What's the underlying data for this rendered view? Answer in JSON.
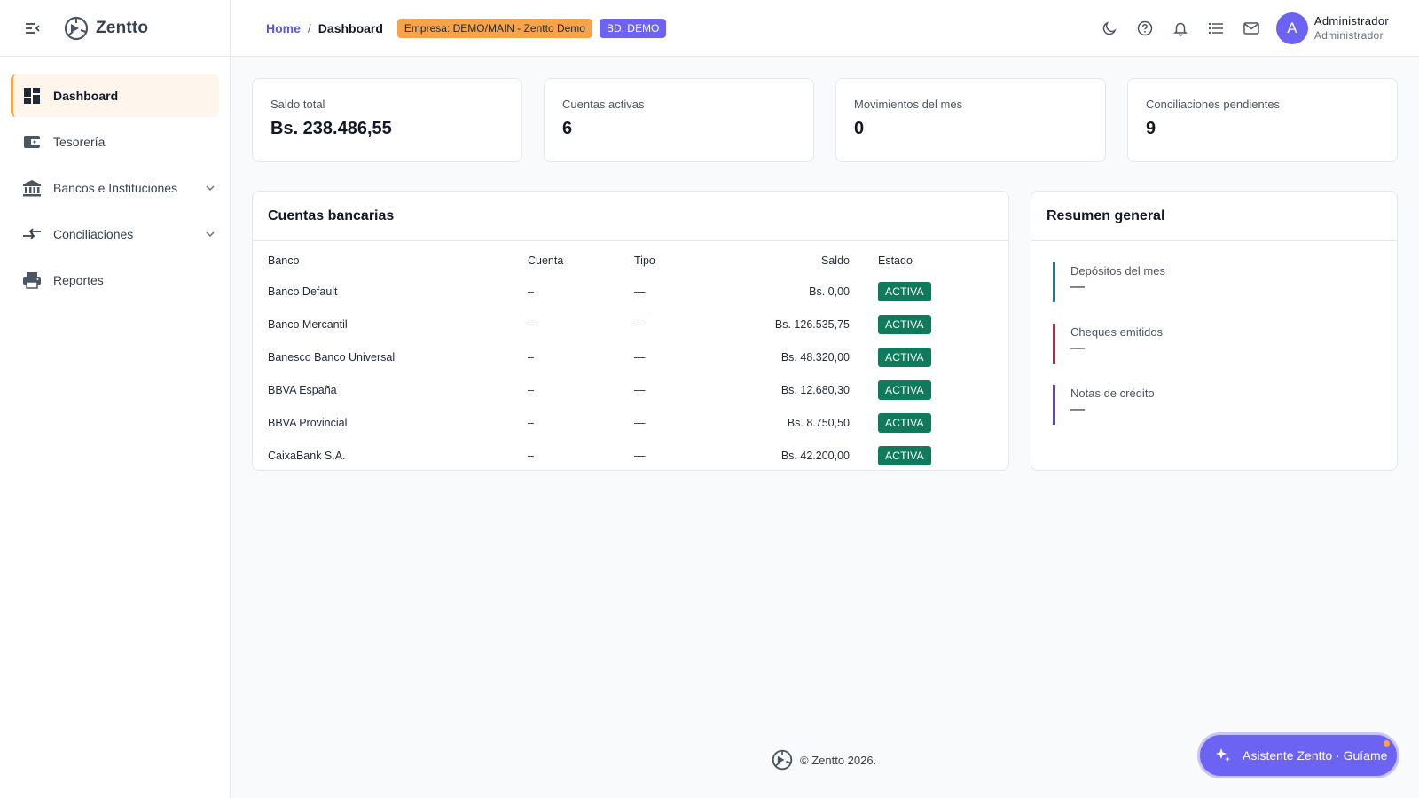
{
  "app": {
    "name": "Zentto"
  },
  "sidebar": {
    "items": [
      {
        "label": "Dashboard",
        "icon": "dashboard-icon",
        "active": true
      },
      {
        "label": "Tesorería",
        "icon": "wallet-icon"
      },
      {
        "label": "Bancos e Instituciones",
        "icon": "bank-icon",
        "expandable": true
      },
      {
        "label": "Conciliaciones",
        "icon": "compare-arrows-icon",
        "expandable": true
      },
      {
        "label": "Reportes",
        "icon": "printer-icon"
      }
    ]
  },
  "header": {
    "breadcrumb": {
      "home": "Home",
      "separator": "/",
      "current": "Dashboard"
    },
    "company_badge": "Empresa: DEMO/MAIN - Zentto Demo",
    "db_badge": "BD: DEMO",
    "icons": [
      "moon-icon",
      "help-icon",
      "bell-icon",
      "list-icon",
      "mail-icon"
    ],
    "user": {
      "initial": "A",
      "name": "Administrador",
      "role": "Administrador"
    }
  },
  "stats": [
    {
      "label": "Saldo total",
      "value": "Bs. 238.486,55"
    },
    {
      "label": "Cuentas activas",
      "value": "6"
    },
    {
      "label": "Movimientos del mes",
      "value": "0"
    },
    {
      "label": "Conciliaciones pendientes",
      "value": "9"
    }
  ],
  "accounts": {
    "title": "Cuentas bancarias",
    "columns": {
      "bank": "Banco",
      "account": "Cuenta",
      "type": "Tipo",
      "balance": "Saldo",
      "status": "Estado"
    },
    "rows": [
      {
        "bank": "Banco Default",
        "account": "–",
        "type": "—",
        "balance": "Bs. 0,00",
        "status": "ACTIVA"
      },
      {
        "bank": "Banco Mercantil",
        "account": "–",
        "type": "—",
        "balance": "Bs. 126.535,75",
        "status": "ACTIVA"
      },
      {
        "bank": "Banesco Banco Universal",
        "account": "–",
        "type": "—",
        "balance": "Bs. 48.320,00",
        "status": "ACTIVA"
      },
      {
        "bank": "BBVA España",
        "account": "–",
        "type": "—",
        "balance": "Bs. 12.680,30",
        "status": "ACTIVA"
      },
      {
        "bank": "BBVA Provincial",
        "account": "–",
        "type": "—",
        "balance": "Bs. 8.750,50",
        "status": "ACTIVA"
      },
      {
        "bank": "CaixaBank S.A.",
        "account": "–",
        "type": "—",
        "balance": "Bs. 42.200,00",
        "status": "ACTIVA"
      }
    ]
  },
  "summary": {
    "title": "Resumen general",
    "items": [
      {
        "label": "Depósitos del mes",
        "value": "—",
        "color": "#1a7b8c"
      },
      {
        "label": "Cheques emitidos",
        "value": "—",
        "color": "#c8193f"
      },
      {
        "label": "Notas de crédito",
        "value": "—",
        "color": "#6b3fb0"
      }
    ]
  },
  "footer": {
    "text": "© Zentto 2026."
  },
  "assistant": {
    "label": "Asistente Zentto · Guíame"
  },
  "colors": {
    "accent": "#6d63f2",
    "orange": "#f6a34a",
    "status_green": "#0f7a5c"
  }
}
